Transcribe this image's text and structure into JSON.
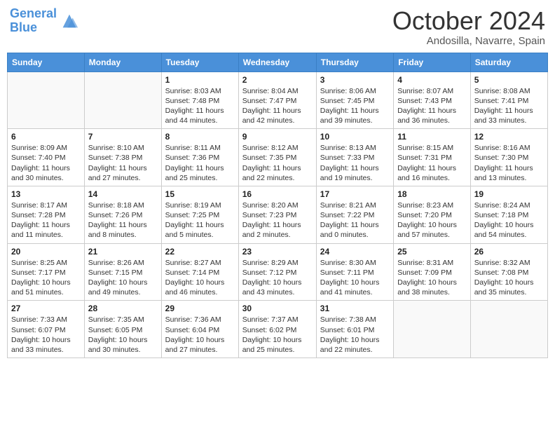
{
  "header": {
    "logo_line1": "General",
    "logo_line2": "Blue",
    "month_year": "October 2024",
    "location": "Andosilla, Navarre, Spain"
  },
  "days_of_week": [
    "Sunday",
    "Monday",
    "Tuesday",
    "Wednesday",
    "Thursday",
    "Friday",
    "Saturday"
  ],
  "weeks": [
    [
      {
        "day": "",
        "content": ""
      },
      {
        "day": "",
        "content": ""
      },
      {
        "day": "1",
        "content": "Sunrise: 8:03 AM\nSunset: 7:48 PM\nDaylight: 11 hours and 44 minutes."
      },
      {
        "day": "2",
        "content": "Sunrise: 8:04 AM\nSunset: 7:47 PM\nDaylight: 11 hours and 42 minutes."
      },
      {
        "day": "3",
        "content": "Sunrise: 8:06 AM\nSunset: 7:45 PM\nDaylight: 11 hours and 39 minutes."
      },
      {
        "day": "4",
        "content": "Sunrise: 8:07 AM\nSunset: 7:43 PM\nDaylight: 11 hours and 36 minutes."
      },
      {
        "day": "5",
        "content": "Sunrise: 8:08 AM\nSunset: 7:41 PM\nDaylight: 11 hours and 33 minutes."
      }
    ],
    [
      {
        "day": "6",
        "content": "Sunrise: 8:09 AM\nSunset: 7:40 PM\nDaylight: 11 hours and 30 minutes."
      },
      {
        "day": "7",
        "content": "Sunrise: 8:10 AM\nSunset: 7:38 PM\nDaylight: 11 hours and 27 minutes."
      },
      {
        "day": "8",
        "content": "Sunrise: 8:11 AM\nSunset: 7:36 PM\nDaylight: 11 hours and 25 minutes."
      },
      {
        "day": "9",
        "content": "Sunrise: 8:12 AM\nSunset: 7:35 PM\nDaylight: 11 hours and 22 minutes."
      },
      {
        "day": "10",
        "content": "Sunrise: 8:13 AM\nSunset: 7:33 PM\nDaylight: 11 hours and 19 minutes."
      },
      {
        "day": "11",
        "content": "Sunrise: 8:15 AM\nSunset: 7:31 PM\nDaylight: 11 hours and 16 minutes."
      },
      {
        "day": "12",
        "content": "Sunrise: 8:16 AM\nSunset: 7:30 PM\nDaylight: 11 hours and 13 minutes."
      }
    ],
    [
      {
        "day": "13",
        "content": "Sunrise: 8:17 AM\nSunset: 7:28 PM\nDaylight: 11 hours and 11 minutes."
      },
      {
        "day": "14",
        "content": "Sunrise: 8:18 AM\nSunset: 7:26 PM\nDaylight: 11 hours and 8 minutes."
      },
      {
        "day": "15",
        "content": "Sunrise: 8:19 AM\nSunset: 7:25 PM\nDaylight: 11 hours and 5 minutes."
      },
      {
        "day": "16",
        "content": "Sunrise: 8:20 AM\nSunset: 7:23 PM\nDaylight: 11 hours and 2 minutes."
      },
      {
        "day": "17",
        "content": "Sunrise: 8:21 AM\nSunset: 7:22 PM\nDaylight: 11 hours and 0 minutes."
      },
      {
        "day": "18",
        "content": "Sunrise: 8:23 AM\nSunset: 7:20 PM\nDaylight: 10 hours and 57 minutes."
      },
      {
        "day": "19",
        "content": "Sunrise: 8:24 AM\nSunset: 7:18 PM\nDaylight: 10 hours and 54 minutes."
      }
    ],
    [
      {
        "day": "20",
        "content": "Sunrise: 8:25 AM\nSunset: 7:17 PM\nDaylight: 10 hours and 51 minutes."
      },
      {
        "day": "21",
        "content": "Sunrise: 8:26 AM\nSunset: 7:15 PM\nDaylight: 10 hours and 49 minutes."
      },
      {
        "day": "22",
        "content": "Sunrise: 8:27 AM\nSunset: 7:14 PM\nDaylight: 10 hours and 46 minutes."
      },
      {
        "day": "23",
        "content": "Sunrise: 8:29 AM\nSunset: 7:12 PM\nDaylight: 10 hours and 43 minutes."
      },
      {
        "day": "24",
        "content": "Sunrise: 8:30 AM\nSunset: 7:11 PM\nDaylight: 10 hours and 41 minutes."
      },
      {
        "day": "25",
        "content": "Sunrise: 8:31 AM\nSunset: 7:09 PM\nDaylight: 10 hours and 38 minutes."
      },
      {
        "day": "26",
        "content": "Sunrise: 8:32 AM\nSunset: 7:08 PM\nDaylight: 10 hours and 35 minutes."
      }
    ],
    [
      {
        "day": "27",
        "content": "Sunrise: 7:33 AM\nSunset: 6:07 PM\nDaylight: 10 hours and 33 minutes."
      },
      {
        "day": "28",
        "content": "Sunrise: 7:35 AM\nSunset: 6:05 PM\nDaylight: 10 hours and 30 minutes."
      },
      {
        "day": "29",
        "content": "Sunrise: 7:36 AM\nSunset: 6:04 PM\nDaylight: 10 hours and 27 minutes."
      },
      {
        "day": "30",
        "content": "Sunrise: 7:37 AM\nSunset: 6:02 PM\nDaylight: 10 hours and 25 minutes."
      },
      {
        "day": "31",
        "content": "Sunrise: 7:38 AM\nSunset: 6:01 PM\nDaylight: 10 hours and 22 minutes."
      },
      {
        "day": "",
        "content": ""
      },
      {
        "day": "",
        "content": ""
      }
    ]
  ]
}
